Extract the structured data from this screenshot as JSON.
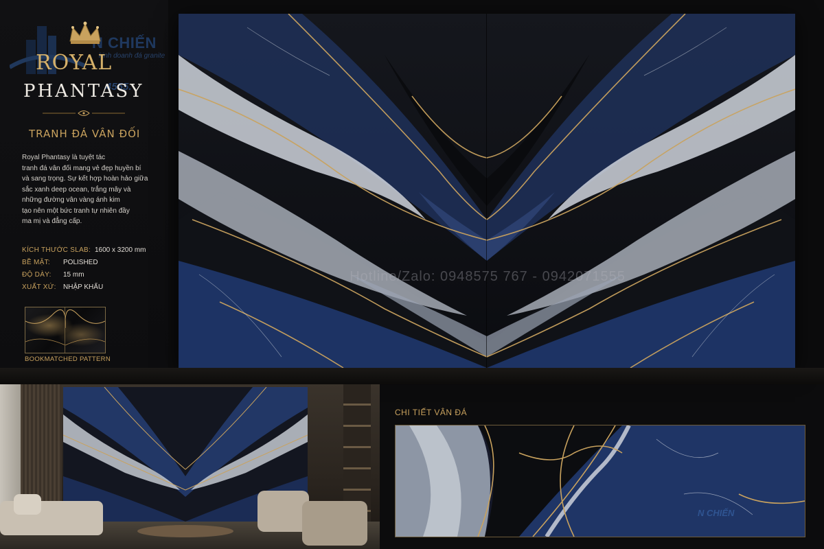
{
  "watermark": {
    "brand": "N CHIẾN",
    "sub": "kinh doanh đá granite",
    "phone": "4555.",
    "slab_text": "Hotline/Zalo: 0948575 767 - 0942071555",
    "detail_text": "N CHIẾN"
  },
  "brand": {
    "line1": "ROYAL",
    "line2": "PHANTASY"
  },
  "subtitle": "TRANH ĐÁ VÂN ĐỐI",
  "description_lines": [
    "Royal Phantasy là tuyệt tác",
    "tranh đá vân đối mang vẻ đẹp huyền bí",
    "và sang trọng. Sự kết hợp hoàn hảo giữa",
    "sắc xanh deep ocean, trắng mây và",
    "những đường vân vàng ánh kim",
    "tạo nên một bức tranh tự nhiên đầy",
    "ma mị và đẳng cấp."
  ],
  "specs": [
    {
      "key": "KÍCH THƯỚC SLAB:",
      "value": "1600 x 3200 mm"
    },
    {
      "key": "BỀ MẶT:",
      "value": "POLISHED"
    },
    {
      "key": "ĐỘ DÀY:",
      "value": "15 mm"
    },
    {
      "key": "XUẤT XỨ:",
      "value": "NHẬP KHẨU"
    }
  ],
  "thumb_caption": "BOOKMATCHED PATTERN",
  "detail_title": "CHI TIẾT VÂN ĐÁ",
  "colors": {
    "gold": "#c9a25e",
    "deep_blue": "#1f3566",
    "black": "#0c0c0d",
    "cloud_white": "#cfd4dc"
  },
  "icons": [
    "crown-icon",
    "divider-ornament"
  ]
}
